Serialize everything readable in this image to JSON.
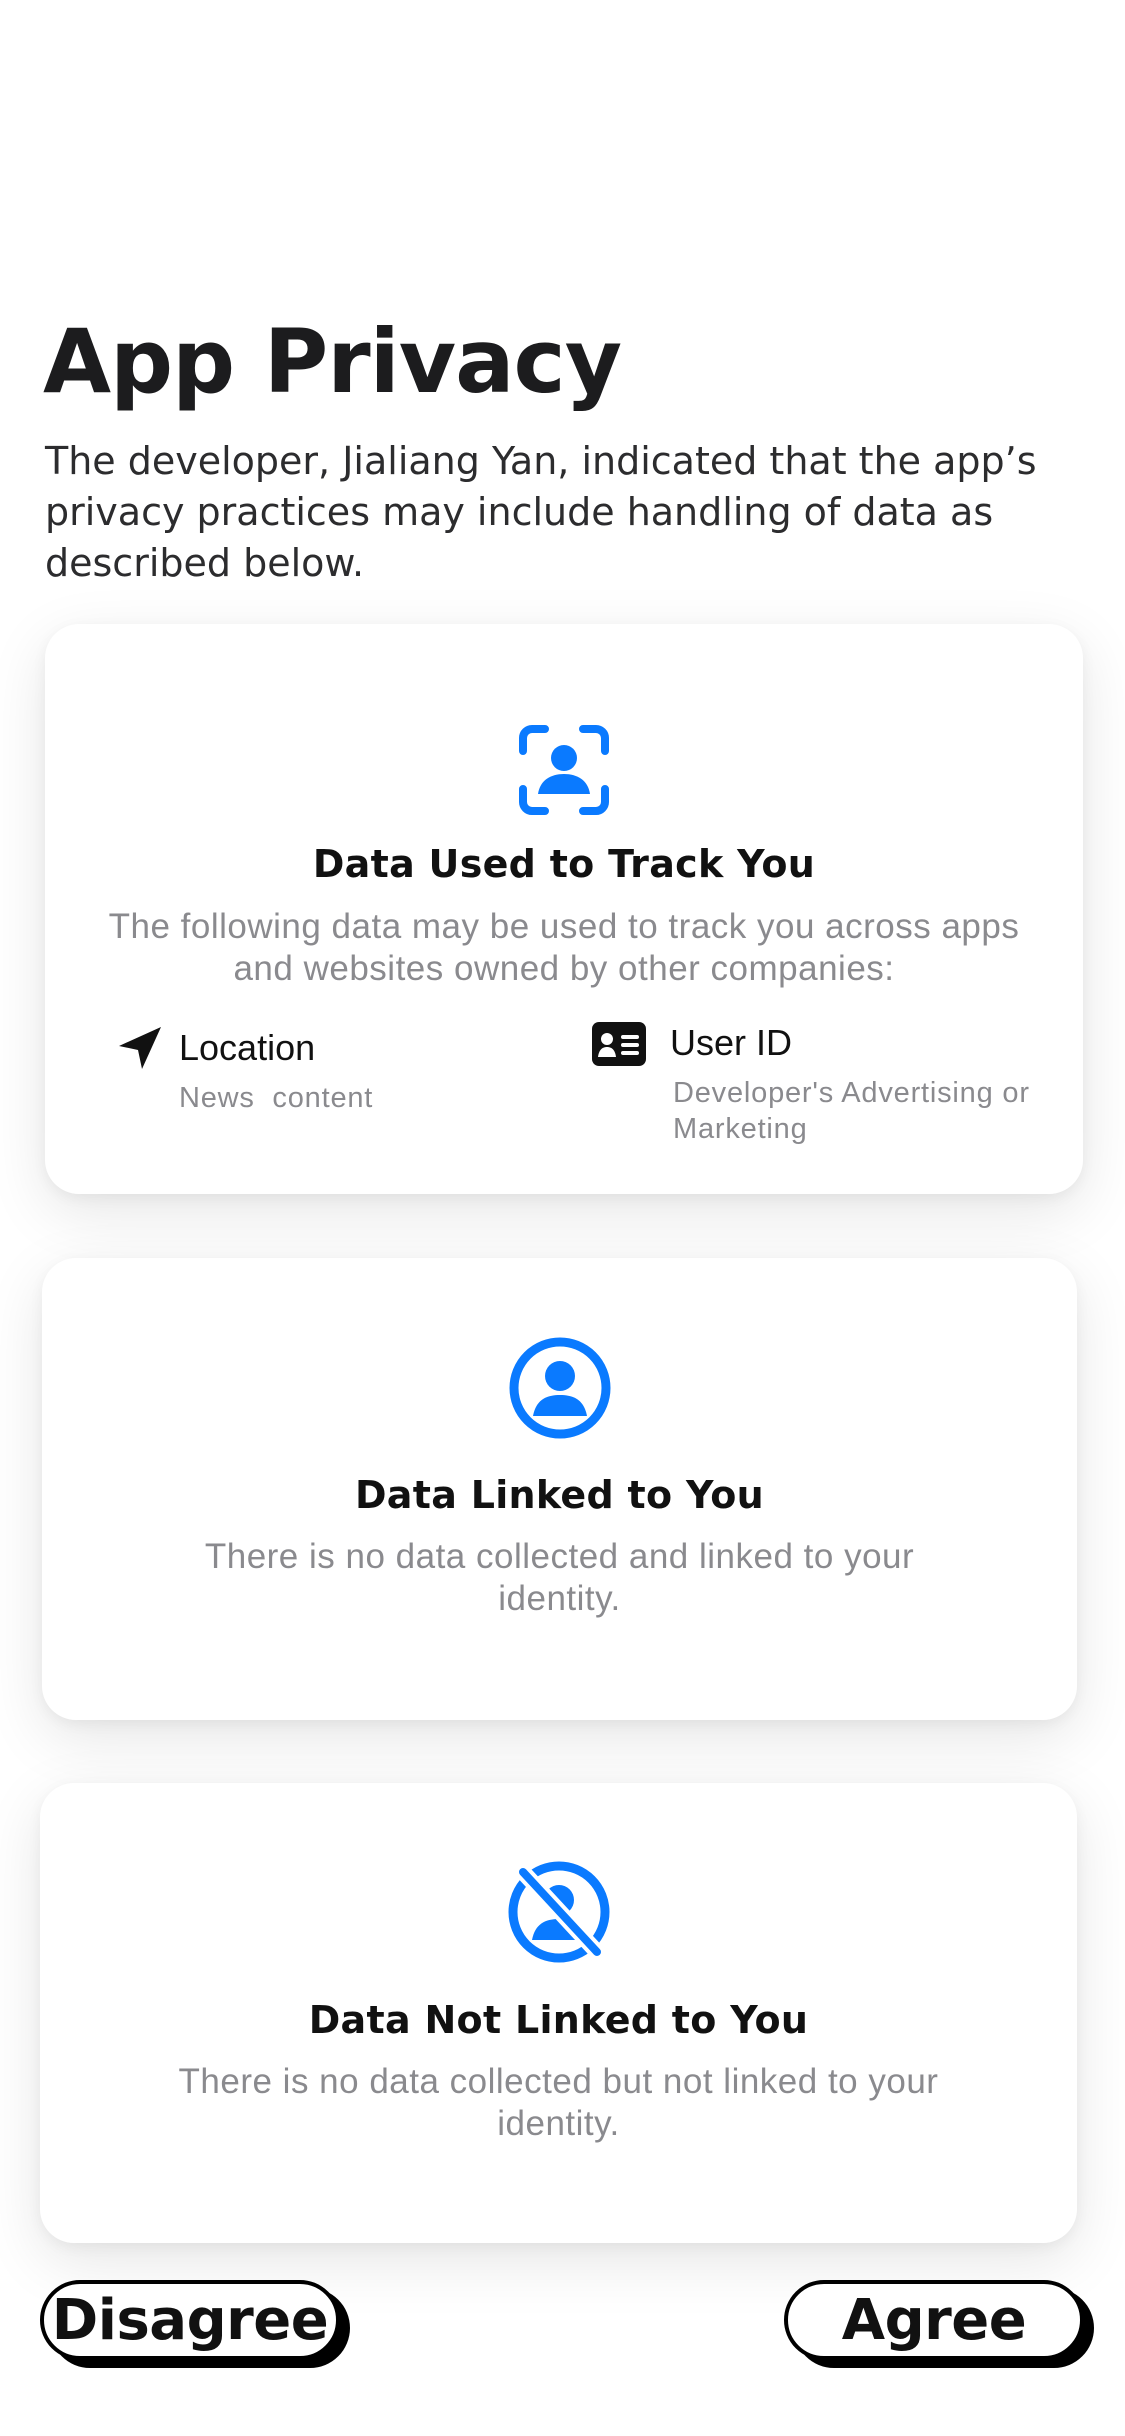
{
  "header": {
    "title": "App Privacy",
    "intro": "The developer, Jialiang Yan, indicated that the app’s privacy practices may include handling of data as described below."
  },
  "sections": [
    {
      "icon": "tracking-icon",
      "title": "Data Used to Track You",
      "description": "The following data may be used to track you across apps and websites owned by other companies:",
      "items": [
        {
          "icon": "location-arrow-icon",
          "label": "Location",
          "purpose": "News  content"
        },
        {
          "icon": "id-card-icon",
          "label": "User ID",
          "purpose": "Developer's Advertising or Marketing"
        }
      ]
    },
    {
      "icon": "person-circle-icon",
      "title": "Data Linked to You",
      "description": "There is no data collected and linked to your identity."
    },
    {
      "icon": "person-slash-icon",
      "title": "Data Not Linked to You",
      "description": "There is no data collected but not linked to your identity."
    }
  ],
  "buttons": {
    "disagree": "Disagree",
    "agree": "Agree"
  },
  "colors": {
    "accent": "#0a7aff",
    "text_primary": "#111111",
    "text_secondary": "#8a8a8e"
  }
}
